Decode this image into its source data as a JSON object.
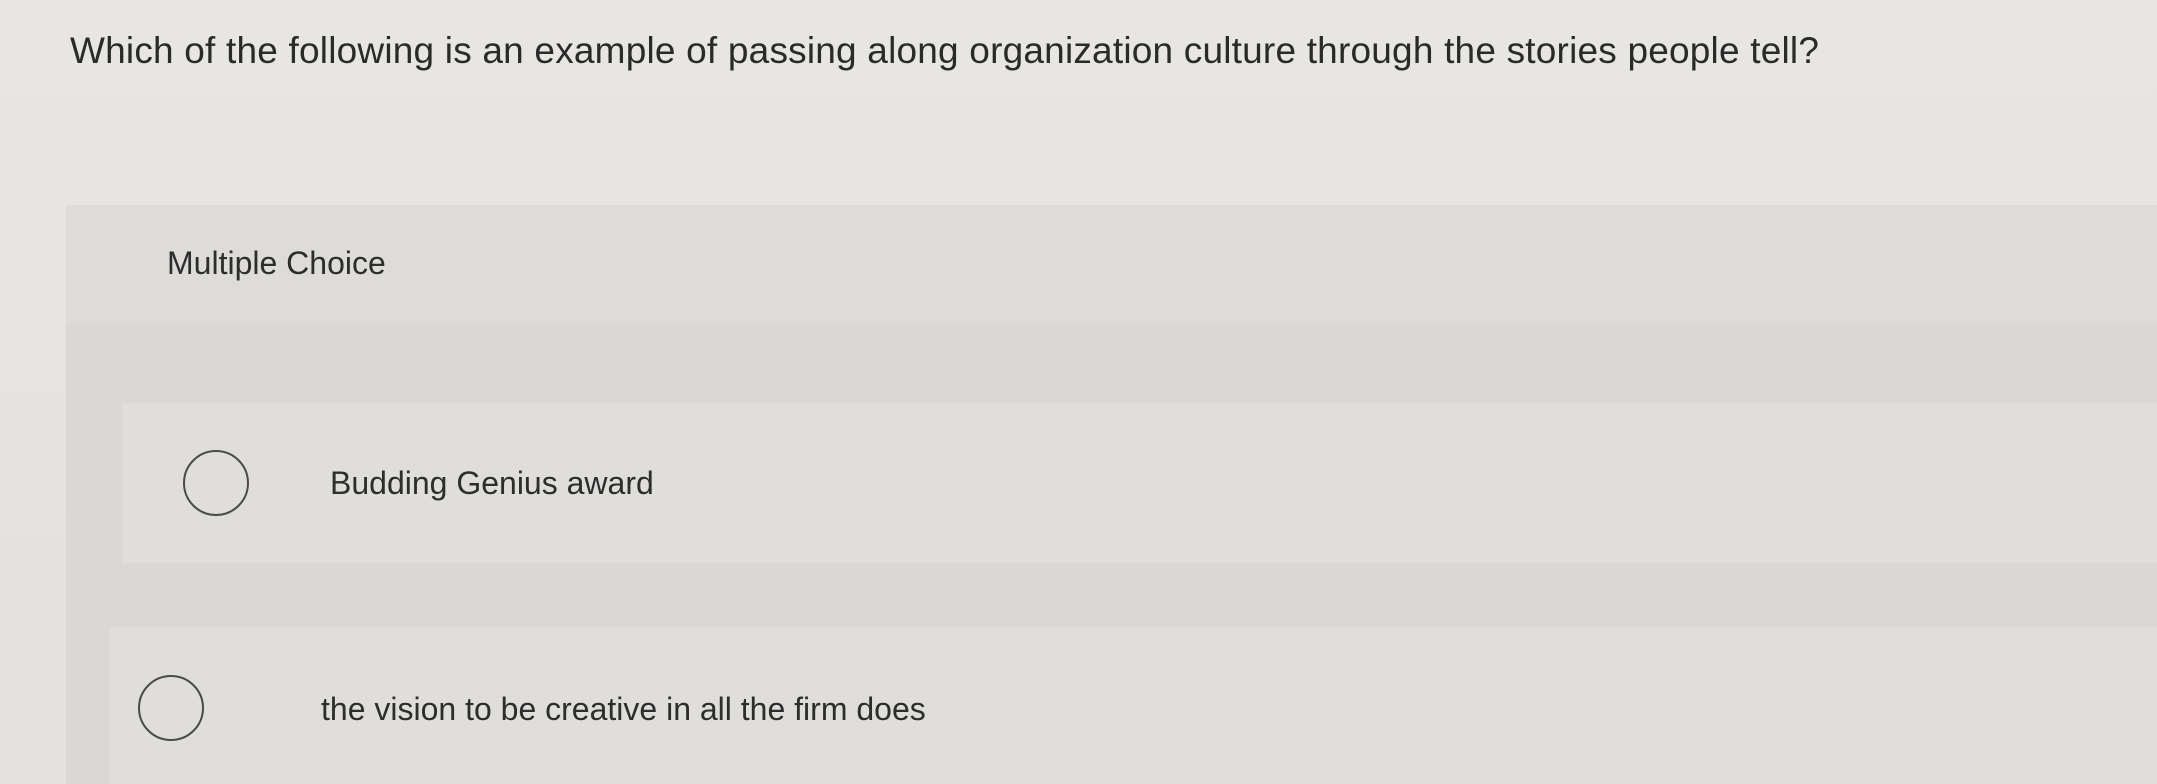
{
  "question": {
    "text": "Which of the following is an example of passing along organization culture through the stories people tell?"
  },
  "choices": {
    "header_label": "Multiple Choice",
    "options": [
      {
        "label": "Budding Genius award",
        "selected": false
      },
      {
        "label": "the vision to be creative in all the firm does",
        "selected": false
      }
    ]
  },
  "colors": {
    "background": "#e6e4e0",
    "panel": "#dddbd8",
    "text": "#2d2d2d",
    "radio_border": "#4a4a4a"
  }
}
